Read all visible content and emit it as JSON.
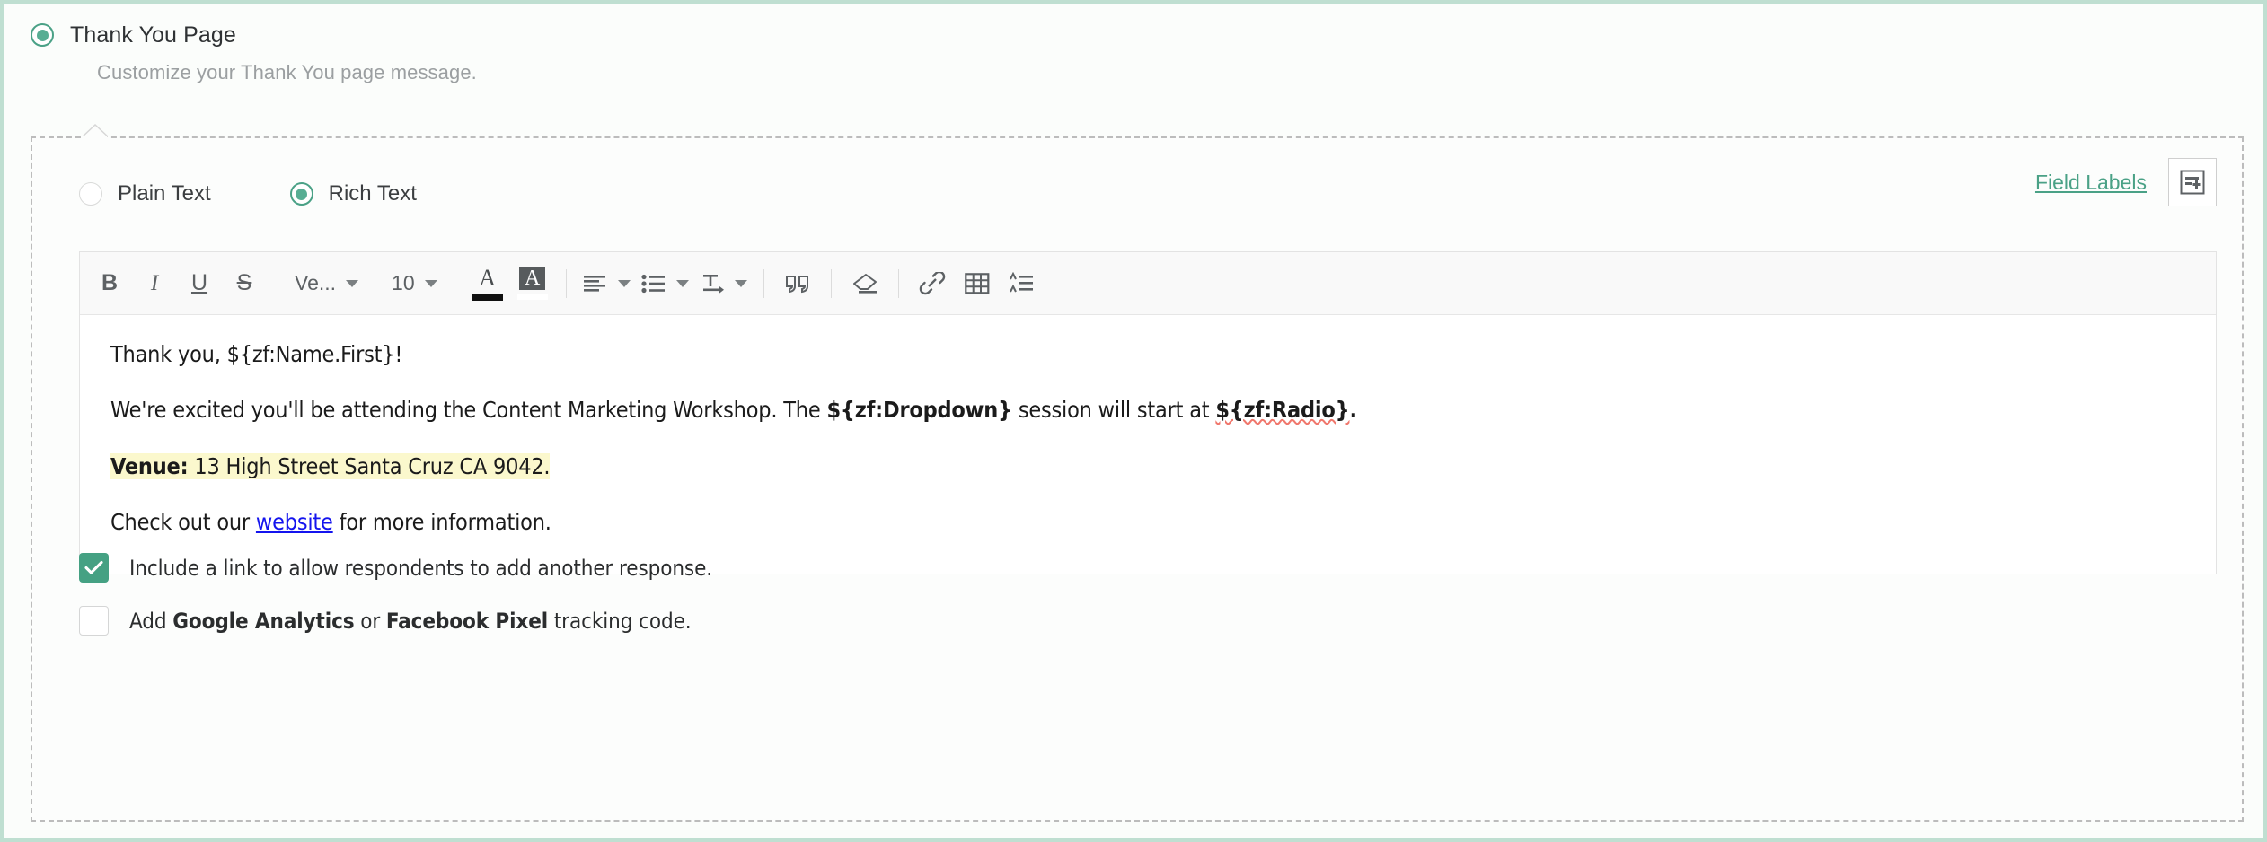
{
  "section": {
    "radio_selected": true,
    "title": "Thank You Page",
    "subtitle": "Customize your Thank You page message."
  },
  "mode": {
    "options": [
      {
        "label": "Plain Text",
        "selected": false
      },
      {
        "label": "Rich Text",
        "selected": true
      }
    ]
  },
  "field_labels": {
    "link_label": "Field Labels",
    "insert_icon": "insert-field-icon"
  },
  "toolbar": {
    "bold": "B",
    "italic": "I",
    "underline": "U",
    "strikethrough": "S",
    "font_family_value": "Ve...",
    "font_size_value": "10",
    "text_color": "A",
    "text_color_swatch": "#111111",
    "highlight": "A",
    "highlight_swatch": "#ffffff",
    "icons": [
      "align-left-icon",
      "bullet-list-icon",
      "indent-icon",
      "blockquote-icon",
      "clear-format-icon",
      "link-icon",
      "table-icon",
      "line-spacing-icon"
    ]
  },
  "editor": {
    "lines": [
      {
        "id": "greeting",
        "text": "Thank you, ${zf:Name.First}!"
      },
      {
        "id": "intro_a",
        "text": "We're excited you'll be attending the Content Marketing Workshop. The "
      },
      {
        "id": "intro_merge1",
        "text": "${zf:Dropdown}"
      },
      {
        "id": "intro_b",
        "text": " session will start at "
      },
      {
        "id": "intro_merge2",
        "text": "${zf:Radio}"
      },
      {
        "id": "intro_c",
        "text": "."
      },
      {
        "id": "venue_label",
        "text": "Venue:"
      },
      {
        "id": "venue_value",
        "text": " 13 High Street Santa Cruz CA 9042."
      },
      {
        "id": "closing_a",
        "text": "Check out our "
      },
      {
        "id": "closing_link",
        "text": "website"
      },
      {
        "id": "closing_b",
        "text": " for more information."
      }
    ]
  },
  "options": {
    "add_another_response": {
      "checked": true,
      "label": "Include a link to allow respondents to add another response."
    },
    "tracking_code": {
      "checked": false,
      "prefix": "Add ",
      "bold1": "Google Analytics",
      "middle": " or ",
      "bold2": "Facebook Pixel",
      "suffix": " tracking code."
    }
  },
  "colors": {
    "accent_green": "#4aa186",
    "checkbox_green": "#45a183",
    "outer_border": "#bfdfd1",
    "highlight_yellow": "#fbf8cd",
    "link_blue": "#1414ee",
    "spellcheck_red": "#f0776c"
  }
}
